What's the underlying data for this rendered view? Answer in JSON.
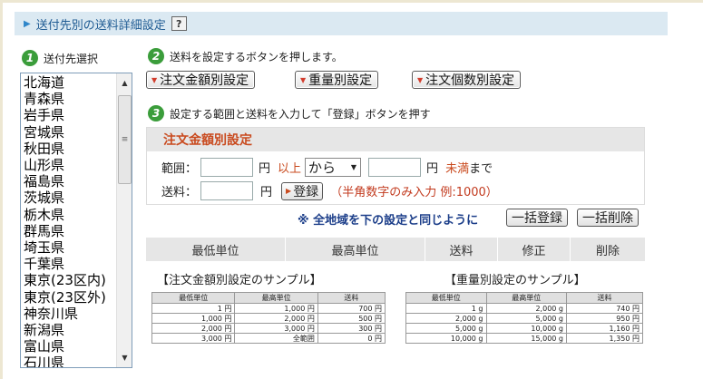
{
  "header": {
    "title": "送付先別の送料詳細設定",
    "help": "?"
  },
  "steps": {
    "s1_num": "1",
    "s1": "送付先選択",
    "s2_num": "2",
    "s2": "送料を設定するボタンを押します。",
    "s3_num": "3",
    "s3": "設定する範囲と送料を入力して「登録」ボタンを押す"
  },
  "prefectures": [
    "北海道",
    "青森県",
    "岩手県",
    "宮城県",
    "秋田県",
    "山形県",
    "福島県",
    "茨城県",
    "栃木県",
    "群馬県",
    "埼玉県",
    "千葉県",
    "東京(23区内)",
    "東京(23区外)",
    "神奈川県",
    "新潟県",
    "富山県",
    "石川県"
  ],
  "type_buttons": [
    "注文金額別設定",
    "重量別設定",
    "注文個数別設定"
  ],
  "form": {
    "title": "注文金額別設定",
    "range_label": "範囲：",
    "yen1": "円",
    "ijou": "以上",
    "select_value": "から",
    "yen2": "円",
    "miman": "未満",
    "made": "まで",
    "fee_label": "送料：",
    "yen3": "円",
    "register": "登録",
    "hint": "（半角数字のみ入力 例:1000）"
  },
  "bulk": {
    "note": "※ 全地域を下の設定と同じように",
    "register_all": "一括登録",
    "delete_all": "一括削除"
  },
  "table_headers": [
    "最低単位",
    "最高単位",
    "送料",
    "修正",
    "削除"
  ],
  "sample_amount": {
    "title": "【注文金額別設定のサンプル】",
    "headers": [
      "最低単位",
      "最高単位",
      "送料"
    ],
    "rows": [
      [
        "1 円",
        "1,000 円",
        "700 円"
      ],
      [
        "1,000 円",
        "2,000 円",
        "500 円"
      ],
      [
        "2,000 円",
        "3,000 円",
        "300 円"
      ],
      [
        "3,000 円",
        "全範囲",
        "0 円"
      ]
    ]
  },
  "sample_weight": {
    "title": "【重量別設定のサンプル】",
    "headers": [
      "最低単位",
      "最高単位",
      "送料"
    ],
    "rows": [
      [
        "1 g",
        "2,000 g",
        "740 円"
      ],
      [
        "2,000 g",
        "5,000 g",
        "950 円"
      ],
      [
        "5,000 g",
        "10,000 g",
        "1,160 円"
      ],
      [
        "10,000 g",
        "15,000 g",
        "1,350 円"
      ]
    ]
  }
}
